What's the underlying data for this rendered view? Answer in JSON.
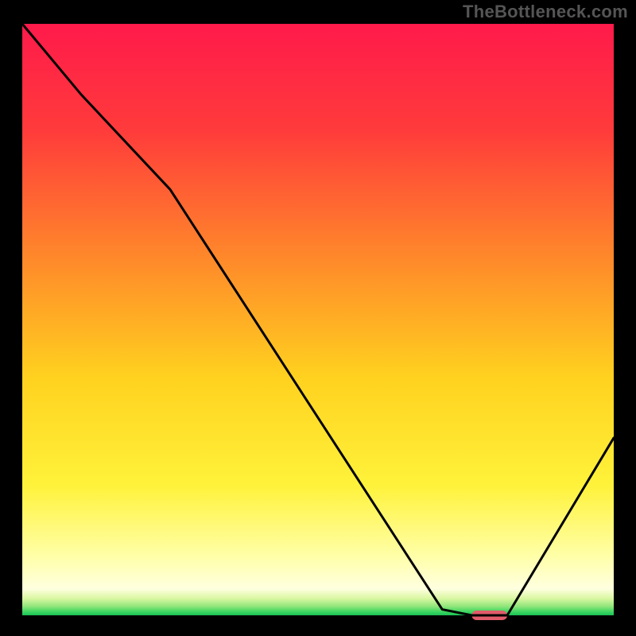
{
  "watermark": "TheBottleneck.com",
  "chart_data": {
    "type": "line",
    "title": "",
    "xlabel": "",
    "ylabel": "",
    "xlim": [
      0,
      100
    ],
    "ylim": [
      0,
      100
    ],
    "series": [
      {
        "name": "curve",
        "x": [
          0,
          10,
          25,
          71,
          76,
          82,
          100
        ],
        "y": [
          100,
          88,
          72,
          1,
          0,
          0,
          30
        ]
      }
    ],
    "marker": {
      "x_start": 76,
      "x_end": 82,
      "y": 0,
      "color": "#e15b6a"
    },
    "gradient_stops": [
      {
        "offset": 0.0,
        "color": "#ff1a4b"
      },
      {
        "offset": 0.18,
        "color": "#ff3b3b"
      },
      {
        "offset": 0.4,
        "color": "#ff8a2a"
      },
      {
        "offset": 0.6,
        "color": "#ffd21f"
      },
      {
        "offset": 0.78,
        "color": "#fff23a"
      },
      {
        "offset": 0.9,
        "color": "#ffffa8"
      },
      {
        "offset": 0.955,
        "color": "#ffffe0"
      },
      {
        "offset": 0.972,
        "color": "#d8f7a0"
      },
      {
        "offset": 0.985,
        "color": "#8fe57a"
      },
      {
        "offset": 0.995,
        "color": "#34d35e"
      },
      {
        "offset": 1.0,
        "color": "#1bc155"
      }
    ]
  }
}
